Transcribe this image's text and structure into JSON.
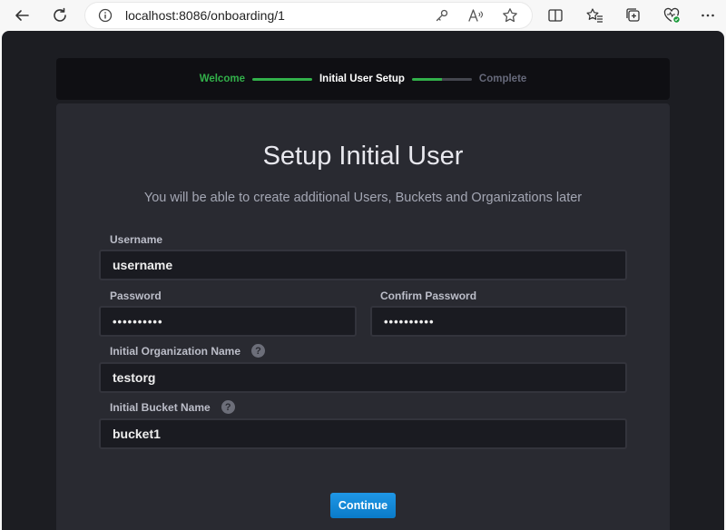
{
  "browser": {
    "url": "localhost:8086/onboarding/1"
  },
  "stepper": {
    "steps": [
      {
        "label": "Welcome",
        "state": "done"
      },
      {
        "label": "Initial User Setup",
        "state": "current"
      },
      {
        "label": "Complete",
        "state": "pending"
      }
    ]
  },
  "form": {
    "title": "Setup Initial User",
    "subtitle": "You will be able to create additional Users, Buckets and Organizations later",
    "username": {
      "label": "Username",
      "value": "username"
    },
    "password": {
      "label": "Password",
      "value": "••••••••••"
    },
    "confirm_password": {
      "label": "Confirm Password",
      "value": "••••••••••"
    },
    "org": {
      "label": "Initial Organization Name",
      "value": "testorg"
    },
    "bucket": {
      "label": "Initial Bucket Name",
      "value": "bucket1"
    },
    "help_glyph": "?",
    "continue_label": "Continue"
  },
  "colors": {
    "step_done": "#32b04a",
    "primary_button": "#0e8ad9",
    "panel": "#292a31",
    "background": "#1c1d22"
  }
}
